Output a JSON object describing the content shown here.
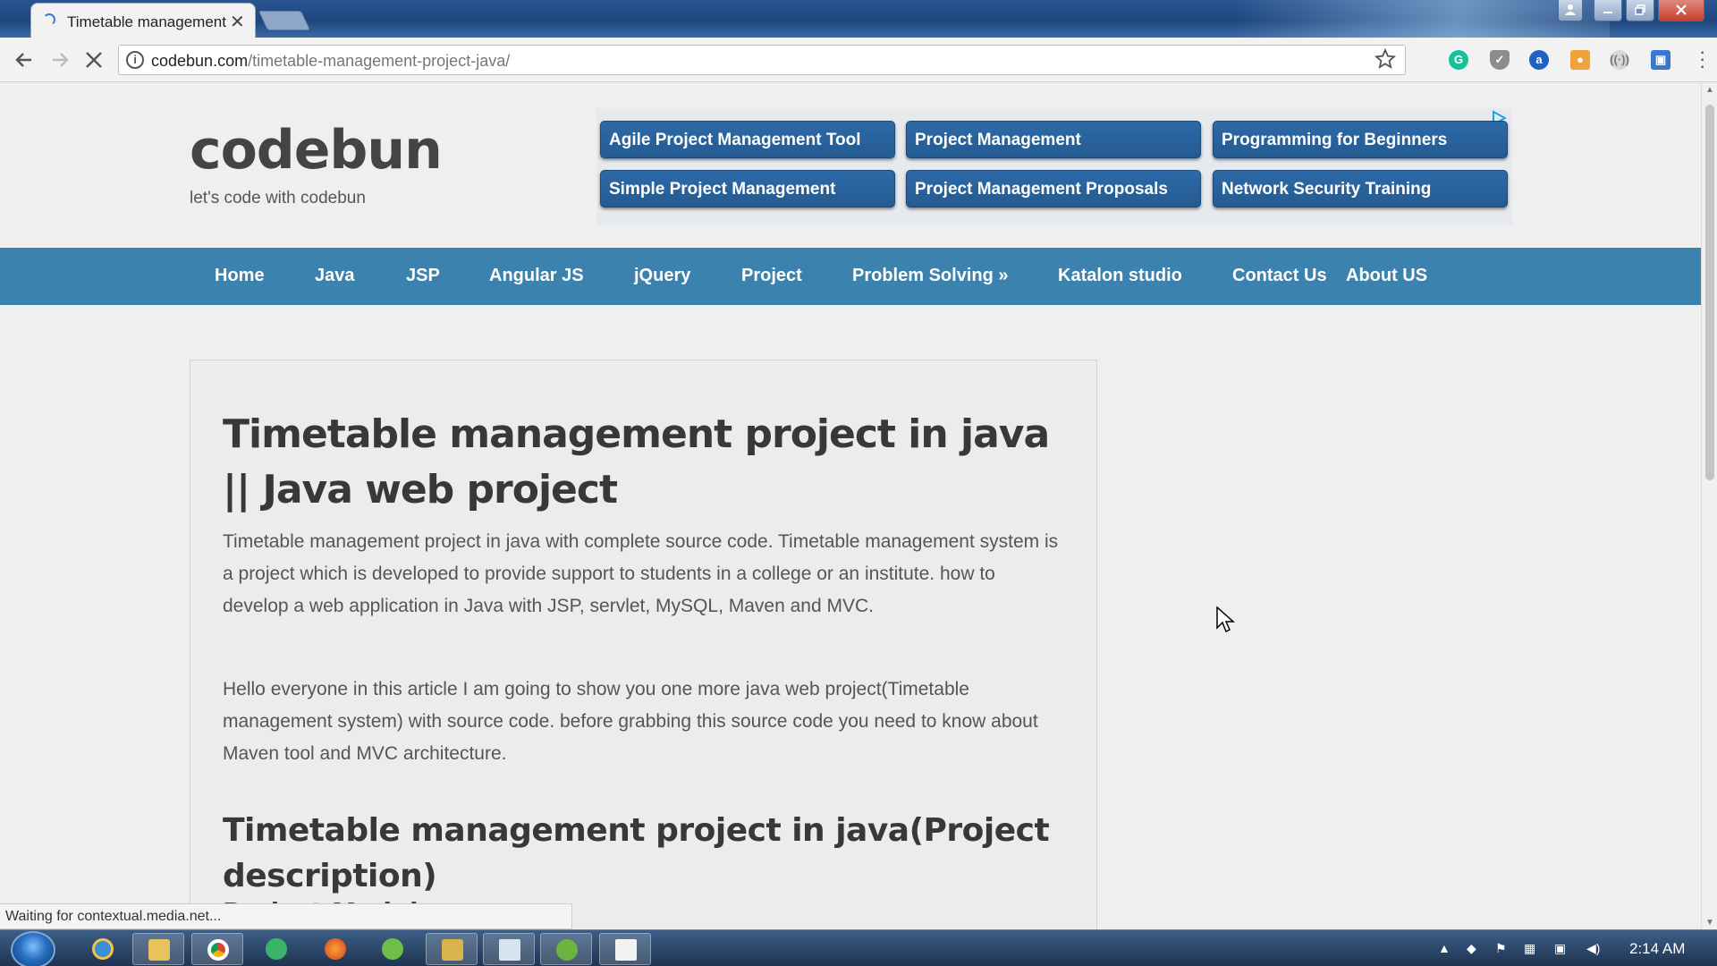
{
  "browser": {
    "tab_title": "Timetable management",
    "tab_close": "✕",
    "url_domain": "codebun.com",
    "url_path": "/timetable-management-project-java/",
    "status_text": "Waiting for contextual.media.net..."
  },
  "site": {
    "logo": "codebun",
    "tagline": "let's code with codebun"
  },
  "ads": [
    "Agile Project Management Tool",
    "Project Management",
    "Programming for Beginners",
    "Simple Project Management",
    "Project Management Proposals",
    "Network Security Training"
  ],
  "nav": [
    "Home",
    "Java",
    "JSP",
    "Angular JS",
    "jQuery",
    "Project",
    "Problem Solving »",
    "Katalon studio",
    "Contact Us",
    "About US"
  ],
  "article": {
    "title": "Timetable management project in java || Java web project",
    "para1": "Timetable management project in java with complete source code. Timetable management system is a project which is developed to provide support to students in a college or an institute. how to develop a web application in Java with JSP, servlet, MySQL, Maven and MVC.",
    "para2": "Hello everyone in this article I am going to show you one more java web project(Timetable management system) with source code. before grabbing this source code you need to know about Maven tool and MVC architecture.",
    "subtitle": "Timetable management project in java(Project description)",
    "next_heading": "Project Modules"
  },
  "taskbar": {
    "clock": "2:14 AM"
  },
  "colors": {
    "nav_bar": "#3b82ae",
    "ad_button": "#245b91",
    "page_bg": "#efefef"
  }
}
